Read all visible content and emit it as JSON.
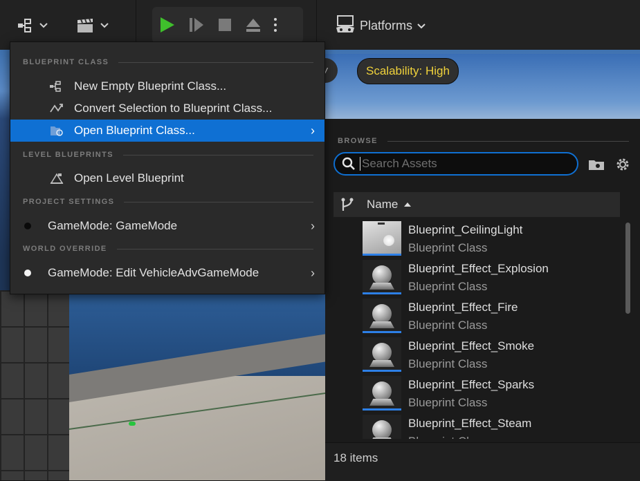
{
  "toolbar": {
    "platforms_label": "Platforms",
    "icons": [
      "blueprint-menu-icon",
      "cinematics-icon",
      "play-icon",
      "advance-frame-icon",
      "stop-icon",
      "eject-icon",
      "more-options-icon",
      "platforms-icon"
    ]
  },
  "viewport": {
    "scalability_label": "Scalability: High",
    "view_mode_label": "W"
  },
  "menu": {
    "sections": {
      "blueprint_class": "BLUEPRINT CLASS",
      "level_blueprints": "LEVEL BLUEPRINTS",
      "project_settings": "PROJECT SETTINGS",
      "world_override": "WORLD OVERRIDE"
    },
    "items": {
      "new_empty": "New Empty Blueprint Class...",
      "convert_selection": "Convert Selection to Blueprint Class...",
      "open_blueprint_class": "Open Blueprint Class...",
      "open_level_blueprint": "Open Level Blueprint",
      "gamemode_project": "GameMode: GameMode",
      "gamemode_world": "GameMode: Edit VehicleAdvGameMode"
    },
    "selected": "open_blueprint_class",
    "accent_color": "#0f70d3"
  },
  "browser": {
    "section_label": "BROWSE",
    "search_placeholder": "Search Assets",
    "column_name": "Name",
    "assets": [
      {
        "name": "Blueprint_CeilingLight",
        "type": "Blueprint Class"
      },
      {
        "name": "Blueprint_Effect_Explosion",
        "type": "Blueprint Class"
      },
      {
        "name": "Blueprint_Effect_Fire",
        "type": "Blueprint Class"
      },
      {
        "name": "Blueprint_Effect_Smoke",
        "type": "Blueprint Class"
      },
      {
        "name": "Blueprint_Effect_Sparks",
        "type": "Blueprint Class"
      },
      {
        "name": "Blueprint_Effect_Steam",
        "type": "Blueprint Class"
      }
    ],
    "item_count": "18 items"
  }
}
